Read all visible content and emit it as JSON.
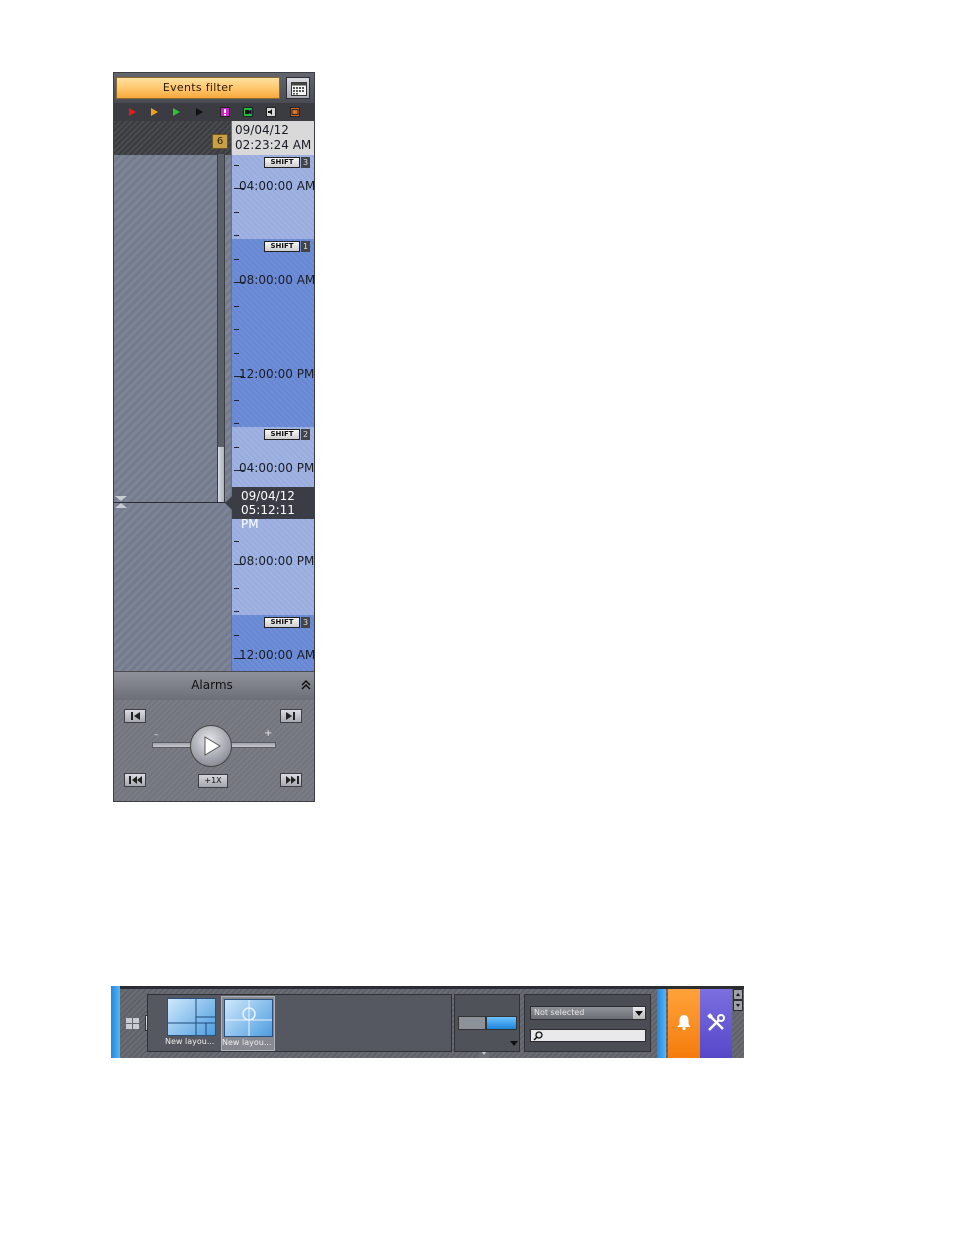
{
  "timeline": {
    "events_filter_label": "Events filter",
    "event_count": "6",
    "top_date": "09/04/12",
    "top_time": "02:23:24 AM",
    "shifts": [
      {
        "label": "SHIFT",
        "number": "3"
      },
      {
        "label": "SHIFT",
        "number": "1"
      },
      {
        "label": "SHIFT",
        "number": "2"
      },
      {
        "label": "SHIFT",
        "number": "3"
      }
    ],
    "time_labels": [
      "04:00:00 AM",
      "08:00:00 AM",
      "12:00:00 PM",
      "04:00:00 PM",
      "08:00:00 PM",
      "12:00:00 AM"
    ],
    "cursor_date": "09/04/12",
    "cursor_time": "05:12:11 PM",
    "event_type_colors": [
      "#e02020",
      "#f0a020",
      "#30c030",
      "#101010",
      "#d020d0",
      "#20c040",
      "#b0b0b0",
      "#e07020"
    ]
  },
  "alarms": {
    "label": "Alarms"
  },
  "player": {
    "minus": "–",
    "plus": "+",
    "speed": "+1X"
  },
  "toolbar": {
    "layouts": [
      {
        "name": "New layou..."
      },
      {
        "name": "New layou..."
      }
    ],
    "camera_select": "Not selected",
    "search_placeholder": ""
  },
  "colors": {
    "accent_blue": "#1e8ae0",
    "alarm_orange": "#f57c0d",
    "settings_purple": "#5647c8",
    "filter_orange": "#ffc56a"
  }
}
